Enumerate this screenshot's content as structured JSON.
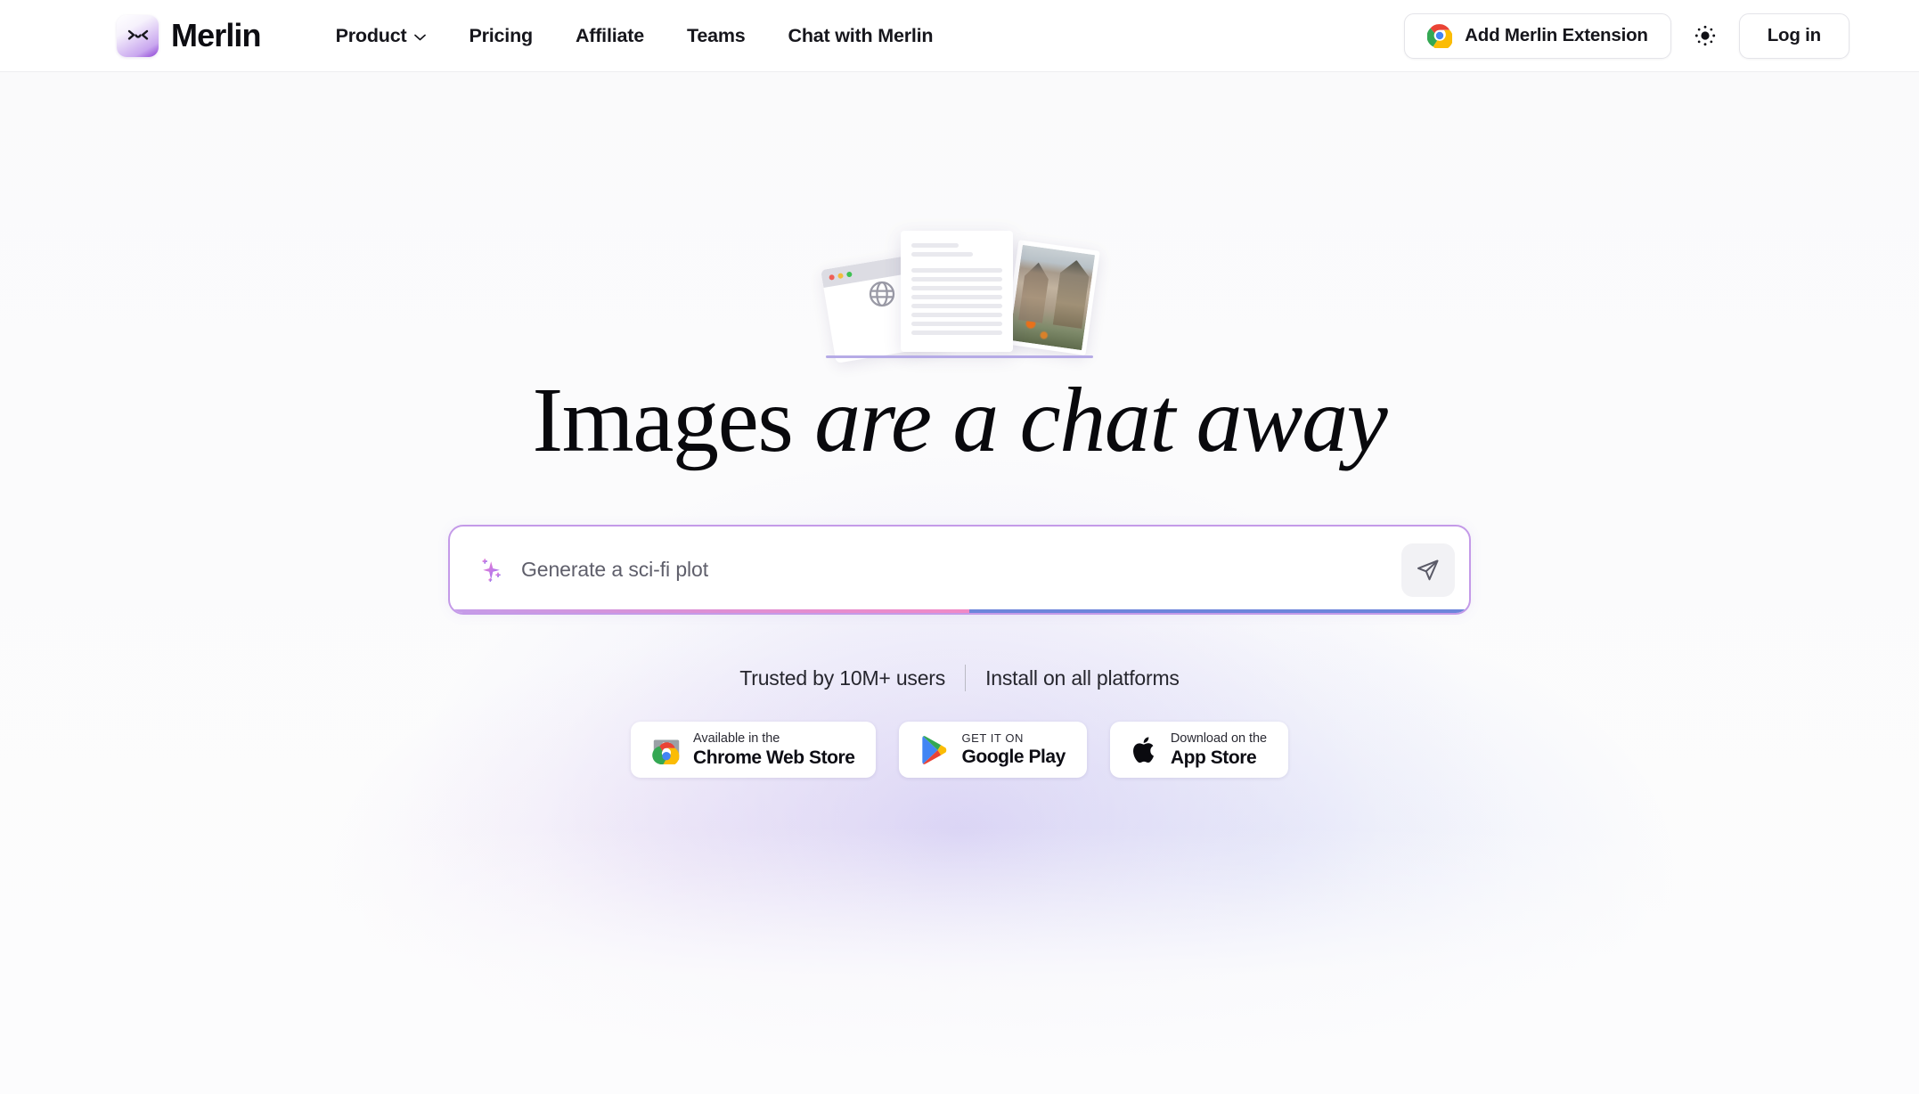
{
  "header": {
    "brand": {
      "name": "Merlin",
      "mark_face": ">‿<"
    },
    "nav": [
      {
        "label": "Product",
        "has_dropdown": true,
        "icon": "chevron-down-icon"
      },
      {
        "label": "Pricing",
        "has_dropdown": false
      },
      {
        "label": "Affiliate",
        "has_dropdown": false
      },
      {
        "label": "Teams",
        "has_dropdown": false
      },
      {
        "label": "Chat with Merlin",
        "has_dropdown": false
      }
    ],
    "extension_button": {
      "label": "Add Merlin Extension",
      "icon": "chrome-icon"
    },
    "theme_toggle": {
      "icon": "sun-icon"
    },
    "login_button": {
      "label": "Log in"
    }
  },
  "hero": {
    "illustration": {
      "icon": "stacked-cards-illustration",
      "browser_icon": "globe-icon",
      "photo_alt": "castle-photo"
    },
    "headline_plain": "Images",
    "headline_italic": "are a chat away"
  },
  "prompt": {
    "sparkle_icon": "sparkle-icon",
    "value": "",
    "placeholder": "Generate a sci-fi plot",
    "send_icon": "send-icon",
    "progress_percent": 51,
    "progress_color_start": "#f089c6",
    "progress_color_end": "#6d85db"
  },
  "trust": {
    "users_text": "Trusted by 10M+ users",
    "platforms_text": "Install on all platforms"
  },
  "badges": [
    {
      "top": "Available in the",
      "main": "Chrome Web Store",
      "icon": "chrome-web-store-icon",
      "caps": false
    },
    {
      "top": "GET IT ON",
      "main": "Google Play",
      "icon": "google-play-icon",
      "caps": true
    },
    {
      "top": "Download on the",
      "main": "App Store",
      "icon": "apple-icon",
      "caps": false
    }
  ],
  "theme": {
    "accent_purple": "#8c3fd4",
    "input_border": "#c49ae8",
    "rule_purple": "#b6abe6",
    "text_dark": "#09090d"
  }
}
